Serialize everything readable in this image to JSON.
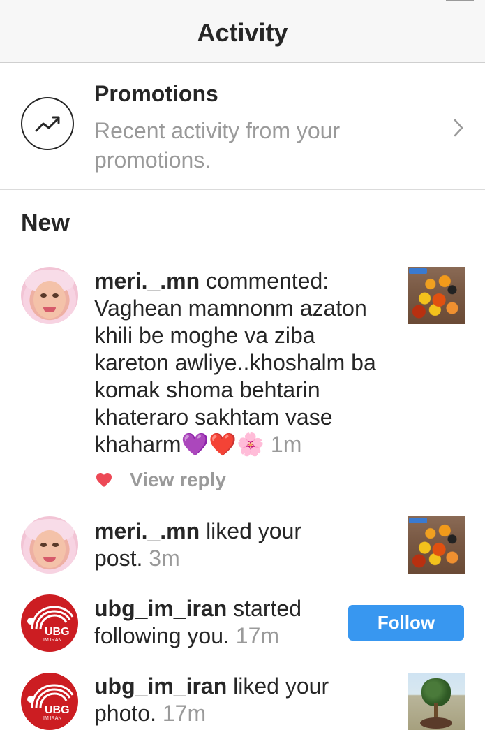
{
  "header": {
    "title": "Activity"
  },
  "promotions": {
    "title": "Promotions",
    "subtitle": "Recent activity from your promotions.",
    "icon": "trending-up-icon"
  },
  "section": {
    "title": "New"
  },
  "activities": [
    {
      "username": "meri._.mn",
      "action": " commented: Vaghean mamnonm azaton khili be moghe va ziba kareton awliye..khoshalm ba komak shoma behtarin khateraro sakhtam vase khaharm",
      "emojis": "💜❤️🌸",
      "time": "1m",
      "reply_label": "View reply",
      "thumbnail": "flowers-balloons-photo"
    },
    {
      "username": "meri._.mn",
      "action": " liked your post.",
      "time": "3m",
      "thumbnail": "flowers-balloons-photo"
    },
    {
      "username": "ubg_im_iran",
      "action": " started following you.",
      "time": "17m",
      "button_label": "Follow"
    },
    {
      "username": "ubg_im_iran",
      "action": " liked your photo.",
      "time": "17m",
      "thumbnail": "potted-tree-photo"
    }
  ],
  "avatars": {
    "ubg_line1": "UBG",
    "ubg_line2": "IM IRAN"
  },
  "colors": {
    "accent": "#3897f0",
    "heart": "#ed4956",
    "muted_text": "#9a9a9a",
    "ubg_red": "#cc1d22"
  }
}
